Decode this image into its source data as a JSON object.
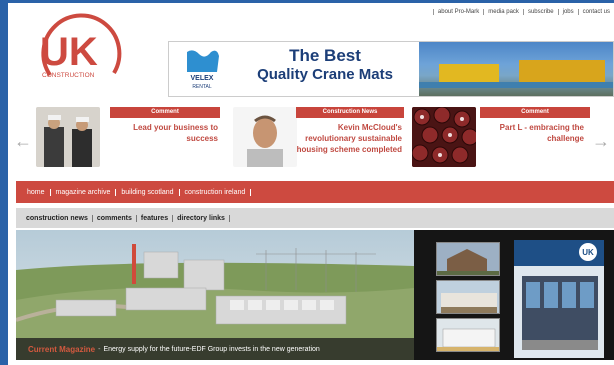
{
  "header": {
    "logo_text": "UK",
    "logo_subtext": "CONSTRUCTION",
    "top_links": [
      "about Pro-Mark",
      "media pack",
      "subscribe",
      "jobs",
      "contact us"
    ]
  },
  "banner": {
    "brand_logo_text": "VELEX",
    "brand_logo_subtext": "RENTAL",
    "headline_line1": "The Best",
    "headline_line2": "Quality Crane Mats"
  },
  "carousel": {
    "items": [
      {
        "tag": "Comment",
        "text": "Lead your business to success"
      },
      {
        "tag": "Construction News",
        "text": "Kevin McCloud's revolutionary sustainable housing scheme completed"
      },
      {
        "tag": "Comment",
        "text": "Part L - embracing the challenge"
      }
    ],
    "left_arrow": "←",
    "right_arrow": "→"
  },
  "nav_primary": [
    "home",
    "magazine archive",
    "building scotland",
    "construction ireland"
  ],
  "nav_secondary": [
    "construction news",
    "comments",
    "features",
    "directory links"
  ],
  "featured": {
    "label": "Current Magazine",
    "separator": "-",
    "story": "Energy supply for the future-EDF Group invests in the new generation"
  },
  "magazine_cover_logo": "UK",
  "colors": {
    "brand_red": "#cd4a40",
    "frame_blue": "#2a62a8",
    "nav_grey": "#d9d9d9",
    "banner_blue": "#1c3e78"
  }
}
